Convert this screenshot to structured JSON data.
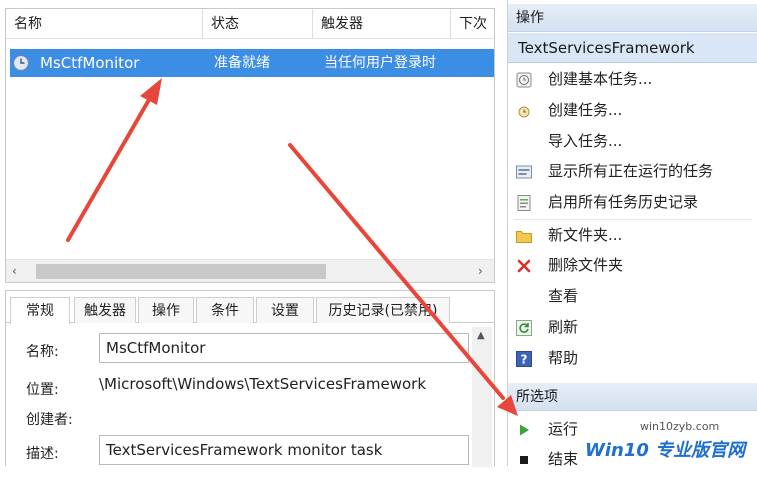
{
  "columns": [
    "名称",
    "状态",
    "触发器",
    "下次"
  ],
  "task": {
    "name": "MsCtfMonitor",
    "status": "准备就绪",
    "trigger": "当任何用户登录时"
  },
  "tabs": [
    "常规",
    "触发器",
    "操作",
    "条件",
    "设置",
    "历史记录(已禁用)"
  ],
  "general": {
    "name_label": "名称:",
    "name_value": "MsCtfMonitor",
    "location_label": "位置:",
    "location_value": "\\Microsoft\\Windows\\TextServicesFramework",
    "author_label": "创建者:",
    "description_label": "描述:",
    "description_value": "TextServicesFramework monitor task"
  },
  "actions_pane": {
    "header": "操作",
    "folder_title": "TextServicesFramework",
    "items": [
      {
        "label": "创建基本任务...",
        "icon": "create-basic-task-icon"
      },
      {
        "label": "创建任务...",
        "icon": "create-task-icon"
      },
      {
        "label": "导入任务...",
        "icon": ""
      },
      {
        "label": "显示所有正在运行的任务",
        "icon": "running-tasks-icon"
      },
      {
        "label": "启用所有任务历史记录",
        "icon": "history-icon"
      },
      {
        "label": "新文件夹...",
        "icon": "folder-icon"
      },
      {
        "label": "删除文件夹",
        "icon": "delete-icon"
      },
      {
        "label": "查看",
        "icon": ""
      },
      {
        "label": "刷新",
        "icon": "refresh-icon"
      },
      {
        "label": "帮助",
        "icon": "help-icon"
      }
    ],
    "selected_header": "所选项",
    "selected_items": [
      {
        "label": "运行",
        "icon": "run-icon"
      },
      {
        "label": "结束",
        "icon": "end-icon"
      }
    ]
  },
  "watermark": {
    "brand": "Win10 专业版官网",
    "url": "win10zyb.com"
  },
  "colors": {
    "selection": "#3c8de4",
    "arrow": "#e8463a",
    "section_header": "#d8e6f5"
  }
}
